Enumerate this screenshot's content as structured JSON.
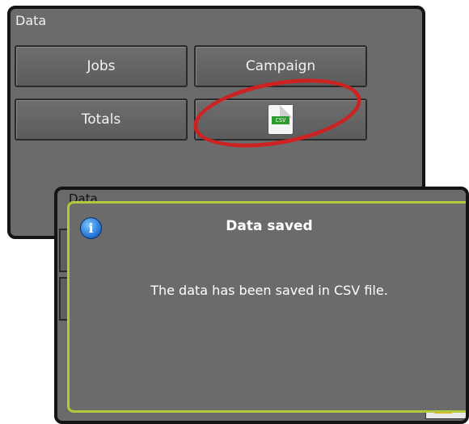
{
  "back_screen": {
    "title": "Data",
    "buttons": {
      "jobs": "Jobs",
      "campaign": "Campaign",
      "totals": "Totals",
      "csv_icon_text": "CSV"
    }
  },
  "front_screen": {
    "background_title": "Data",
    "dialog": {
      "icon": "info-icon",
      "title": "Data saved",
      "message": "The data has been saved in CSV file."
    }
  },
  "colors": {
    "panel": "#6b6b6b",
    "dialog_border": "#b4c83c",
    "highlight": "#cc2222",
    "info_blue": "#1f6fd1"
  }
}
